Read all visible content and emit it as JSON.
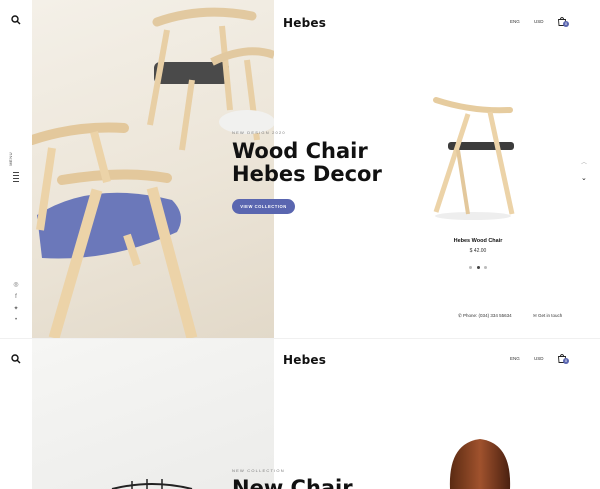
{
  "sidebar": {
    "menu_label": "MENU"
  },
  "header": {
    "logo": "Hebes",
    "language": "ENG",
    "currency": "USD",
    "cart_count": "0"
  },
  "hero": {
    "subtitle": "NEW DESIGN 2020",
    "title_line1": "Wood Chair",
    "title_line2": "Hebes Decor",
    "cta_label": "VIEW COLLECTION"
  },
  "product": {
    "name": "Hebes Wood Chair",
    "price": "$ 42.00"
  },
  "contact": {
    "phone": "Phone: (034) 334 55634",
    "get_in_touch": "Get in touch"
  },
  "section2": {
    "logo": "Hebes",
    "language": "ENG",
    "currency": "USD",
    "cart_count": "0",
    "subtitle": "NEW COLLECTION",
    "title": "New Chair"
  },
  "colors": {
    "accent": "#5a66b0",
    "hero_bg": "#ece5d8"
  }
}
